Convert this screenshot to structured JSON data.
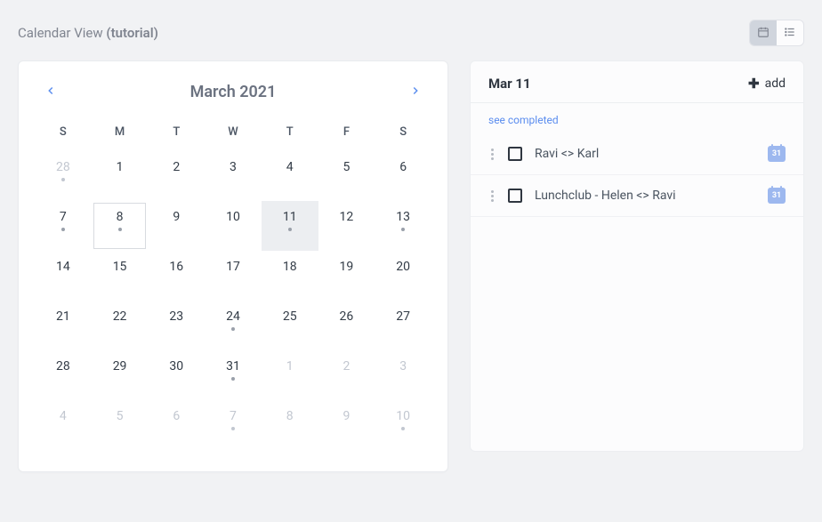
{
  "header": {
    "title_prefix": "Calendar View ",
    "title_suffix": "(tutorial)"
  },
  "viewToggle": {
    "calendar_icon": "calendar",
    "list_icon": "list"
  },
  "calendar": {
    "title": "March 2021",
    "dows": [
      "S",
      "M",
      "T",
      "W",
      "T",
      "F",
      "S"
    ],
    "days": [
      {
        "n": "28",
        "other": true,
        "dot": true
      },
      {
        "n": "1"
      },
      {
        "n": "2"
      },
      {
        "n": "3"
      },
      {
        "n": "4"
      },
      {
        "n": "5"
      },
      {
        "n": "6"
      },
      {
        "n": "7",
        "dot": true
      },
      {
        "n": "8",
        "today": true,
        "dot": true
      },
      {
        "n": "9"
      },
      {
        "n": "10"
      },
      {
        "n": "11",
        "selected": true,
        "dot": true
      },
      {
        "n": "12"
      },
      {
        "n": "13",
        "dot": true
      },
      {
        "n": "14"
      },
      {
        "n": "15"
      },
      {
        "n": "16"
      },
      {
        "n": "17"
      },
      {
        "n": "18"
      },
      {
        "n": "19"
      },
      {
        "n": "20"
      },
      {
        "n": "21"
      },
      {
        "n": "22"
      },
      {
        "n": "23"
      },
      {
        "n": "24",
        "dot": true
      },
      {
        "n": "25"
      },
      {
        "n": "26"
      },
      {
        "n": "27"
      },
      {
        "n": "28"
      },
      {
        "n": "29"
      },
      {
        "n": "30"
      },
      {
        "n": "31",
        "dot": true
      },
      {
        "n": "1",
        "other": true
      },
      {
        "n": "2",
        "other": true
      },
      {
        "n": "3",
        "other": true
      },
      {
        "n": "4",
        "other": true
      },
      {
        "n": "5",
        "other": true
      },
      {
        "n": "6",
        "other": true
      },
      {
        "n": "7",
        "other": true,
        "dot": true
      },
      {
        "n": "8",
        "other": true
      },
      {
        "n": "9",
        "other": true
      },
      {
        "n": "10",
        "other": true,
        "dot": true
      }
    ]
  },
  "side": {
    "date_label": "Mar 11",
    "add_label": "add",
    "see_completed_label": "see completed",
    "cal_badge_text": "31",
    "tasks": [
      {
        "title": "Ravi <> Karl"
      },
      {
        "title": "Lunchclub - Helen <> Ravi"
      }
    ]
  }
}
